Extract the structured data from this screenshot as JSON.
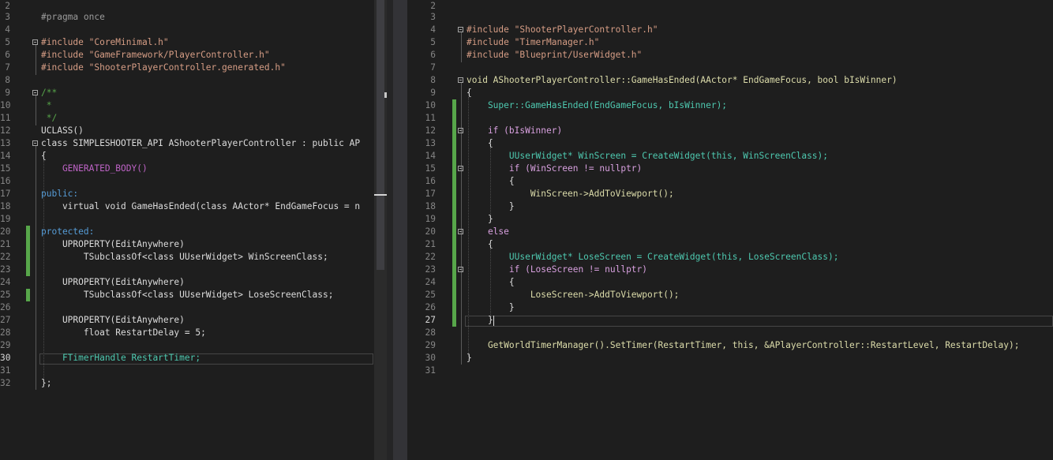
{
  "left_file": {
    "lines": [
      {
        "n": "2",
        "t": ""
      },
      {
        "n": "3",
        "t": "#pragma once"
      },
      {
        "n": "4",
        "t": ""
      },
      {
        "n": "5",
        "t": "#include \"CoreMinimal.h\""
      },
      {
        "n": "6",
        "t": "#include \"GameFramework/PlayerController.h\""
      },
      {
        "n": "7",
        "t": "#include \"ShooterPlayerController.generated.h\""
      },
      {
        "n": "8",
        "t": ""
      },
      {
        "n": "9",
        "t": "/**"
      },
      {
        "n": "10",
        "t": " *"
      },
      {
        "n": "11",
        "t": " */"
      },
      {
        "n": "12",
        "t": "UCLASS()"
      },
      {
        "n": "13",
        "t": "class SIMPLESHOOTER_API AShooterPlayerController : public AP"
      },
      {
        "n": "14",
        "t": "{"
      },
      {
        "n": "15",
        "t": "    GENERATED_BODY()"
      },
      {
        "n": "16",
        "t": ""
      },
      {
        "n": "17",
        "t": "public:"
      },
      {
        "n": "18",
        "t": "    virtual void GameHasEnded(class AActor* EndGameFocus = n"
      },
      {
        "n": "19",
        "t": ""
      },
      {
        "n": "20",
        "t": "protected:"
      },
      {
        "n": "21",
        "t": "    UPROPERTY(EditAnywhere)"
      },
      {
        "n": "22",
        "t": "        TSubclassOf<class UUserWidget> WinScreenClass;"
      },
      {
        "n": "23",
        "t": ""
      },
      {
        "n": "24",
        "t": "    UPROPERTY(EditAnywhere)"
      },
      {
        "n": "25",
        "t": "        TSubclassOf<class UUserWidget> LoseScreenClass;"
      },
      {
        "n": "26",
        "t": ""
      },
      {
        "n": "27",
        "t": "    UPROPERTY(EditAnywhere)"
      },
      {
        "n": "28",
        "t": "        float RestartDelay = 5;"
      },
      {
        "n": "29",
        "t": ""
      },
      {
        "n": "30",
        "t": "    FTimerHandle RestartTimer;"
      },
      {
        "n": "31",
        "t": ""
      },
      {
        "n": "32",
        "t": "};"
      }
    ]
  },
  "right_file": {
    "lines": [
      {
        "n": "2",
        "t": ""
      },
      {
        "n": "3",
        "t": ""
      },
      {
        "n": "4",
        "t": "#include \"ShooterPlayerController.h\""
      },
      {
        "n": "5",
        "t": "#include \"TimerManager.h\""
      },
      {
        "n": "6",
        "t": "#include \"Blueprint/UserWidget.h\""
      },
      {
        "n": "7",
        "t": ""
      },
      {
        "n": "8",
        "t": "void AShooterPlayerController::GameHasEnded(AActor* EndGameFocus, bool bIsWinner)"
      },
      {
        "n": "9",
        "t": "{"
      },
      {
        "n": "10",
        "t": "    Super::GameHasEnded(EndGameFocus, bIsWinner);"
      },
      {
        "n": "11",
        "t": ""
      },
      {
        "n": "12",
        "t": "    if (bIsWinner)"
      },
      {
        "n": "13",
        "t": "    {"
      },
      {
        "n": "14",
        "t": "        UUserWidget* WinScreen = CreateWidget(this, WinScreenClass);"
      },
      {
        "n": "15",
        "t": "        if (WinScreen != nullptr)"
      },
      {
        "n": "16",
        "t": "        {"
      },
      {
        "n": "17",
        "t": "            WinScreen->AddToViewport();"
      },
      {
        "n": "18",
        "t": "        }"
      },
      {
        "n": "19",
        "t": "    }"
      },
      {
        "n": "20",
        "t": "    else"
      },
      {
        "n": "21",
        "t": "    {"
      },
      {
        "n": "22",
        "t": "        UUserWidget* LoseScreen = CreateWidget(this, LoseScreenClass);"
      },
      {
        "n": "23",
        "t": "        if (LoseScreen != nullptr)"
      },
      {
        "n": "24",
        "t": "        {"
      },
      {
        "n": "25",
        "t": "            LoseScreen->AddToViewport();"
      },
      {
        "n": "26",
        "t": "        }"
      },
      {
        "n": "27",
        "t": "    }"
      },
      {
        "n": "28",
        "t": ""
      },
      {
        "n": "29",
        "t": "    GetWorldTimerManager().SetTimer(RestartTimer, this, &APlayerController::RestartLevel, RestartDelay);"
      },
      {
        "n": "30",
        "t": "}"
      },
      {
        "n": "31",
        "t": ""
      }
    ]
  },
  "colors": {
    "background": "#1e1e1e",
    "keyword": "#569cd6",
    "string": "#d69d85",
    "comment": "#57a64a",
    "type": "#4ec9b0",
    "function": "#dcdcaa",
    "change_marker": "#57a64a"
  }
}
